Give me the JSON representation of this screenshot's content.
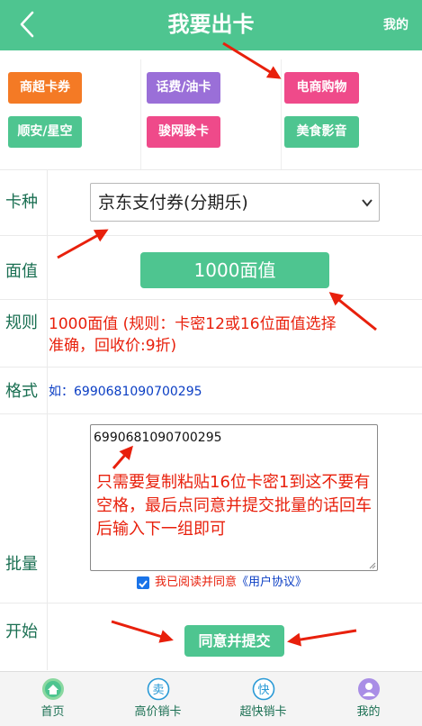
{
  "header": {
    "title": "我要出卡",
    "mine": "我的"
  },
  "categories": [
    {
      "label": "商超卡券",
      "color": "#f47a25"
    },
    {
      "label": "话费/油卡",
      "color": "#9a6fd8"
    },
    {
      "label": "电商购物",
      "color": "#ef4a8a"
    },
    {
      "label": "顺安/星空",
      "color": "#4ec590"
    },
    {
      "label": "骏网骏卡",
      "color": "#ef4a8a"
    },
    {
      "label": "美食影音",
      "color": "#4ec590"
    }
  ],
  "form": {
    "card_type_label": "卡种",
    "card_type_value": "京东支付券(分期乐)",
    "face_value_label": "面值",
    "face_value_button": "1000面值",
    "rules_label": "规则",
    "rules_text": "1000面值    (规则：卡密12或16位面值选择准确，回收价:9折)",
    "format_label": "格式",
    "format_text": "如：6990681090700295",
    "batch_label": "批量",
    "batch_value": "6990681090700295",
    "batch_hint": "只需要复制粘贴16位卡密1到这不要有空格，最后点同意并提交批量的话回车后输入下一组即可",
    "agree_text": "我已阅读并同意",
    "agree_link": "《用户协议》",
    "start_label": "开始",
    "submit_label": "同意并提交"
  },
  "tabbar": [
    {
      "label": "首页",
      "icon": "home-icon",
      "glyph": ""
    },
    {
      "label": "高价销卡",
      "icon": "sell-icon",
      "glyph": "卖"
    },
    {
      "label": "超快销卡",
      "icon": "fast-icon",
      "glyph": "快"
    },
    {
      "label": "我的",
      "icon": "user-icon",
      "glyph": ""
    }
  ],
  "colors": {
    "brand": "#4ec590",
    "label_text": "#1a6f52",
    "alert_red": "#e8200c",
    "link_blue": "#0b3ec4"
  }
}
